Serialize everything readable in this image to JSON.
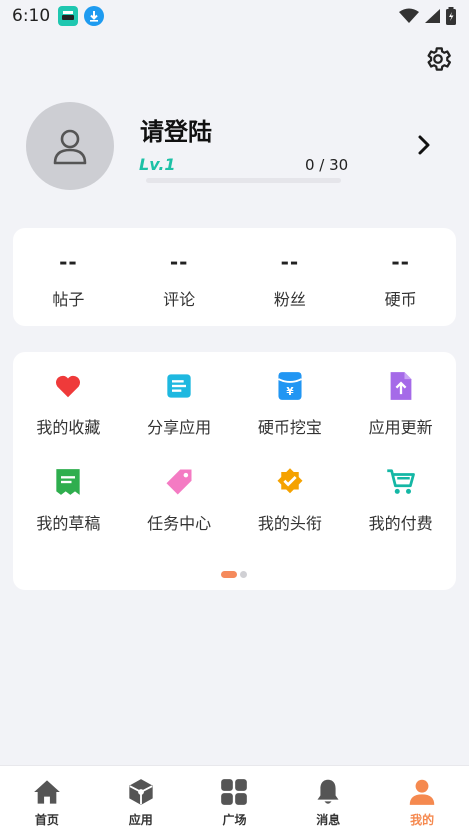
{
  "status_bar": {
    "time": "6:10"
  },
  "profile": {
    "name": "请登陆",
    "level": "Lv.1",
    "progress_text": "0 / 30",
    "progress_fraction": 0
  },
  "stats": [
    {
      "value": "--",
      "label": "帖子"
    },
    {
      "value": "--",
      "label": "评论"
    },
    {
      "value": "--",
      "label": "粉丝"
    },
    {
      "value": "--",
      "label": "硬币"
    }
  ],
  "menu": {
    "items": [
      {
        "label": "我的收藏",
        "icon": "heart-icon",
        "color": "#ef3a3a"
      },
      {
        "label": "分享应用",
        "icon": "document-icon",
        "color": "#1eb8e0"
      },
      {
        "label": "硬币挖宝",
        "icon": "coin-envelope-icon",
        "color": "#2196f3"
      },
      {
        "label": "应用更新",
        "icon": "file-upload-icon",
        "color": "#a56ae8"
      },
      {
        "label": "我的草稿",
        "icon": "draft-icon",
        "color": "#2fae4e"
      },
      {
        "label": "任务中心",
        "icon": "tag-icon",
        "color": "#f47bc3"
      },
      {
        "label": "我的头衔",
        "icon": "verified-badge-icon",
        "color": "#f5a200"
      },
      {
        "label": "我的付费",
        "icon": "cart-icon",
        "color": "#14b7a5"
      }
    ],
    "page_count": 2,
    "current_page": 1
  },
  "bottom_nav": [
    {
      "label": "首页",
      "icon": "home-icon"
    },
    {
      "label": "应用",
      "icon": "cube-icon"
    },
    {
      "label": "广场",
      "icon": "grid-icon"
    },
    {
      "label": "消息",
      "icon": "bell-icon"
    },
    {
      "label": "我的",
      "icon": "person-icon",
      "active": true
    }
  ],
  "colors": {
    "accent": "#f5894f",
    "level": "#1cc1a6",
    "background": "#f2f3f7"
  }
}
